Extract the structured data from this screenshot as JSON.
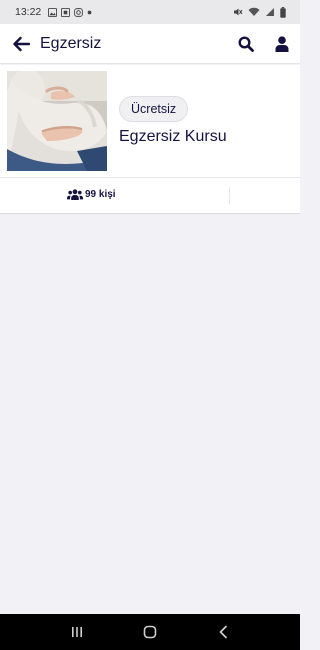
{
  "status_bar": {
    "time": "13:22",
    "left_icons": [
      "image-icon",
      "sim-card-icon",
      "instagram-icon",
      "dot-icon"
    ],
    "right_icons": [
      "mute-icon",
      "wifi-icon",
      "signal-icon",
      "battery-icon"
    ]
  },
  "app_bar": {
    "title": "Egzersiz",
    "icons": [
      "back-arrow-icon",
      "search-icon",
      "user-icon"
    ]
  },
  "course": {
    "badge": "Ücretsiz",
    "title": "Egzersiz Kursu",
    "participants": "99 kişi",
    "participants_icon": "users-icon"
  },
  "nav_bar": {
    "icons": [
      "recent-apps-icon",
      "home-icon",
      "back-icon"
    ]
  },
  "colors": {
    "primary": "#161240",
    "background": "#f2f2f6",
    "surface": "#ffffff",
    "status_bar": "#e9e9ec",
    "nav_bar": "#000000"
  }
}
